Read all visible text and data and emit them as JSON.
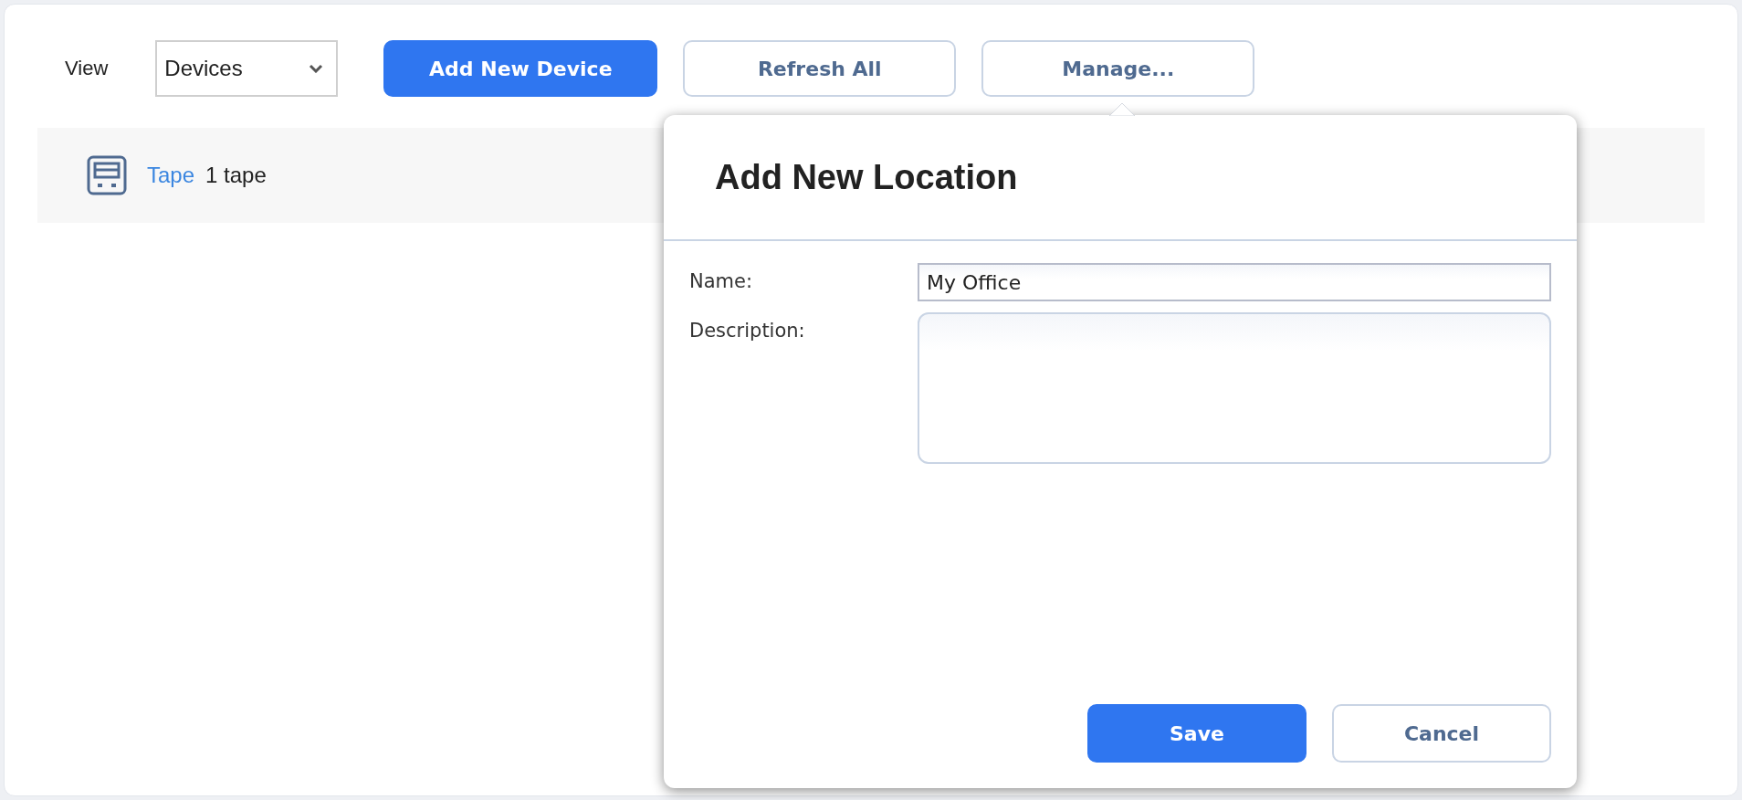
{
  "toolbar": {
    "view_label": "View",
    "view_select": {
      "value": "Devices"
    },
    "buttons": [
      {
        "label": "Add New Device",
        "kind": "primary"
      },
      {
        "label": "Refresh All",
        "kind": "secondary"
      },
      {
        "label": "Manage...",
        "kind": "secondary"
      }
    ]
  },
  "devices": [
    {
      "name": "Tape",
      "count": "1 tape"
    }
  ],
  "popover": {
    "title": "Add New Location",
    "fields": [
      {
        "label": "Name:",
        "kind": "text",
        "value": "My Office"
      },
      {
        "label": "Description:",
        "kind": "textarea"
      }
    ],
    "buttons": [
      {
        "label": "Save",
        "kind": "primary"
      },
      {
        "label": "Cancel",
        "kind": "secondary"
      }
    ]
  }
}
